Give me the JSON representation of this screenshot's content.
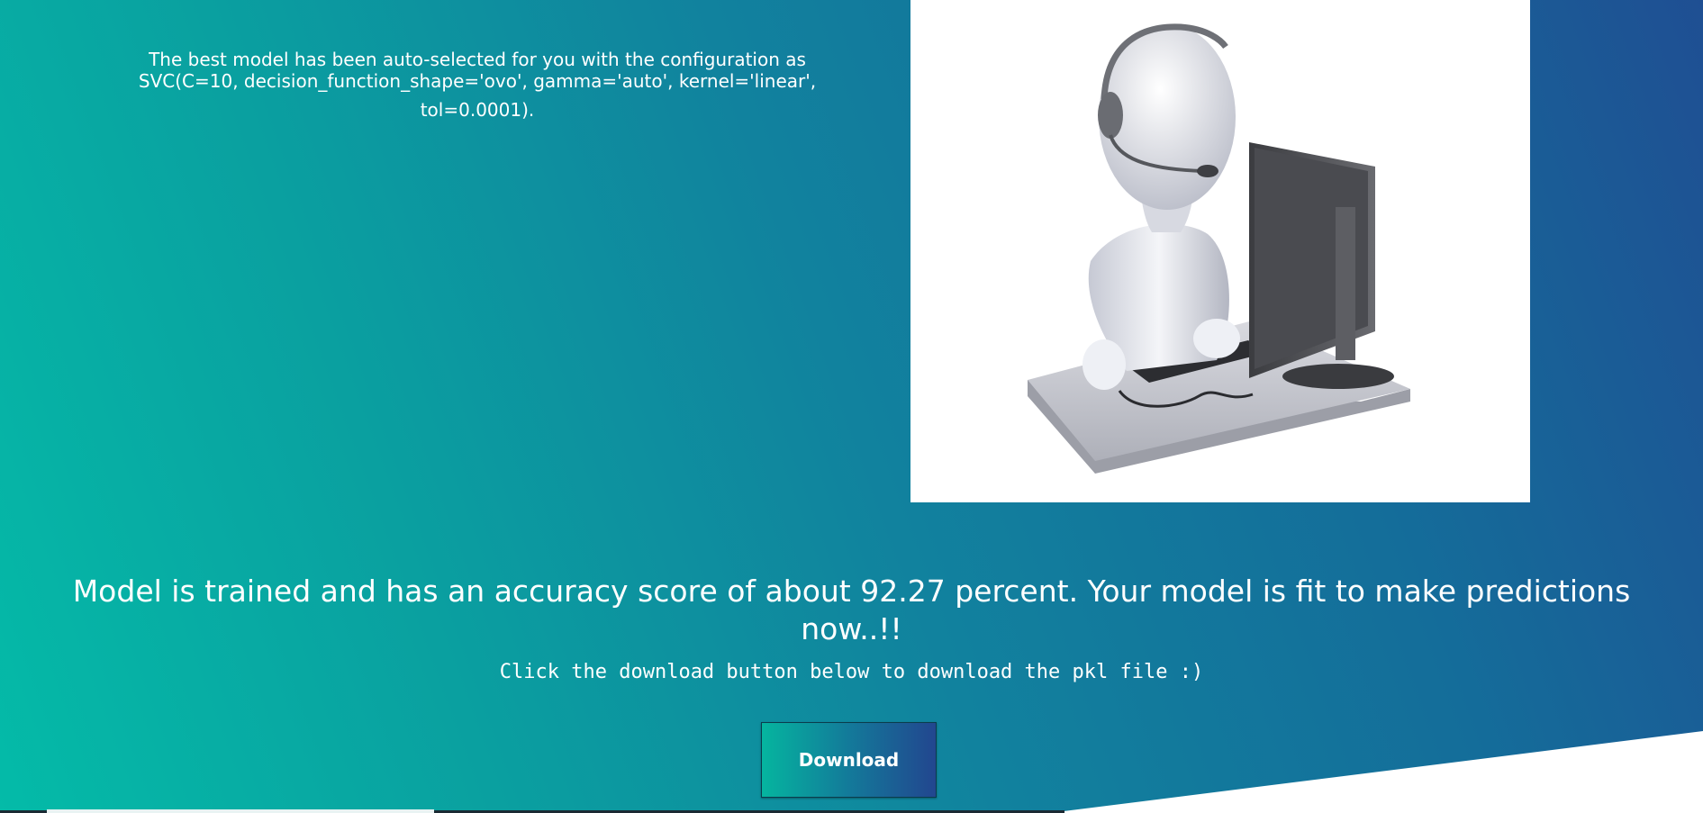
{
  "model": {
    "config_line_1": "The best model has been auto-selected for you with the configuration as",
    "config_line_2": "SVC(C=10, decision_function_shape='ovo', gamma='auto', kernel='linear',",
    "config_line_3": "tol=0.0001)."
  },
  "result": {
    "title": "Model is trained and has an accuracy score of about 92.27 percent. Your model is fit to make predictions now..!!",
    "subtitle": "Click the download button below to download the pkl file :)"
  },
  "actions": {
    "download_label": "Download"
  },
  "illustration": {
    "icon": "support-agent-computer-illustration"
  },
  "colors": {
    "gradient_start": "#04bba8",
    "gradient_end": "#1f4f93",
    "text": "#ffffff",
    "wedge": "#ffffff"
  }
}
